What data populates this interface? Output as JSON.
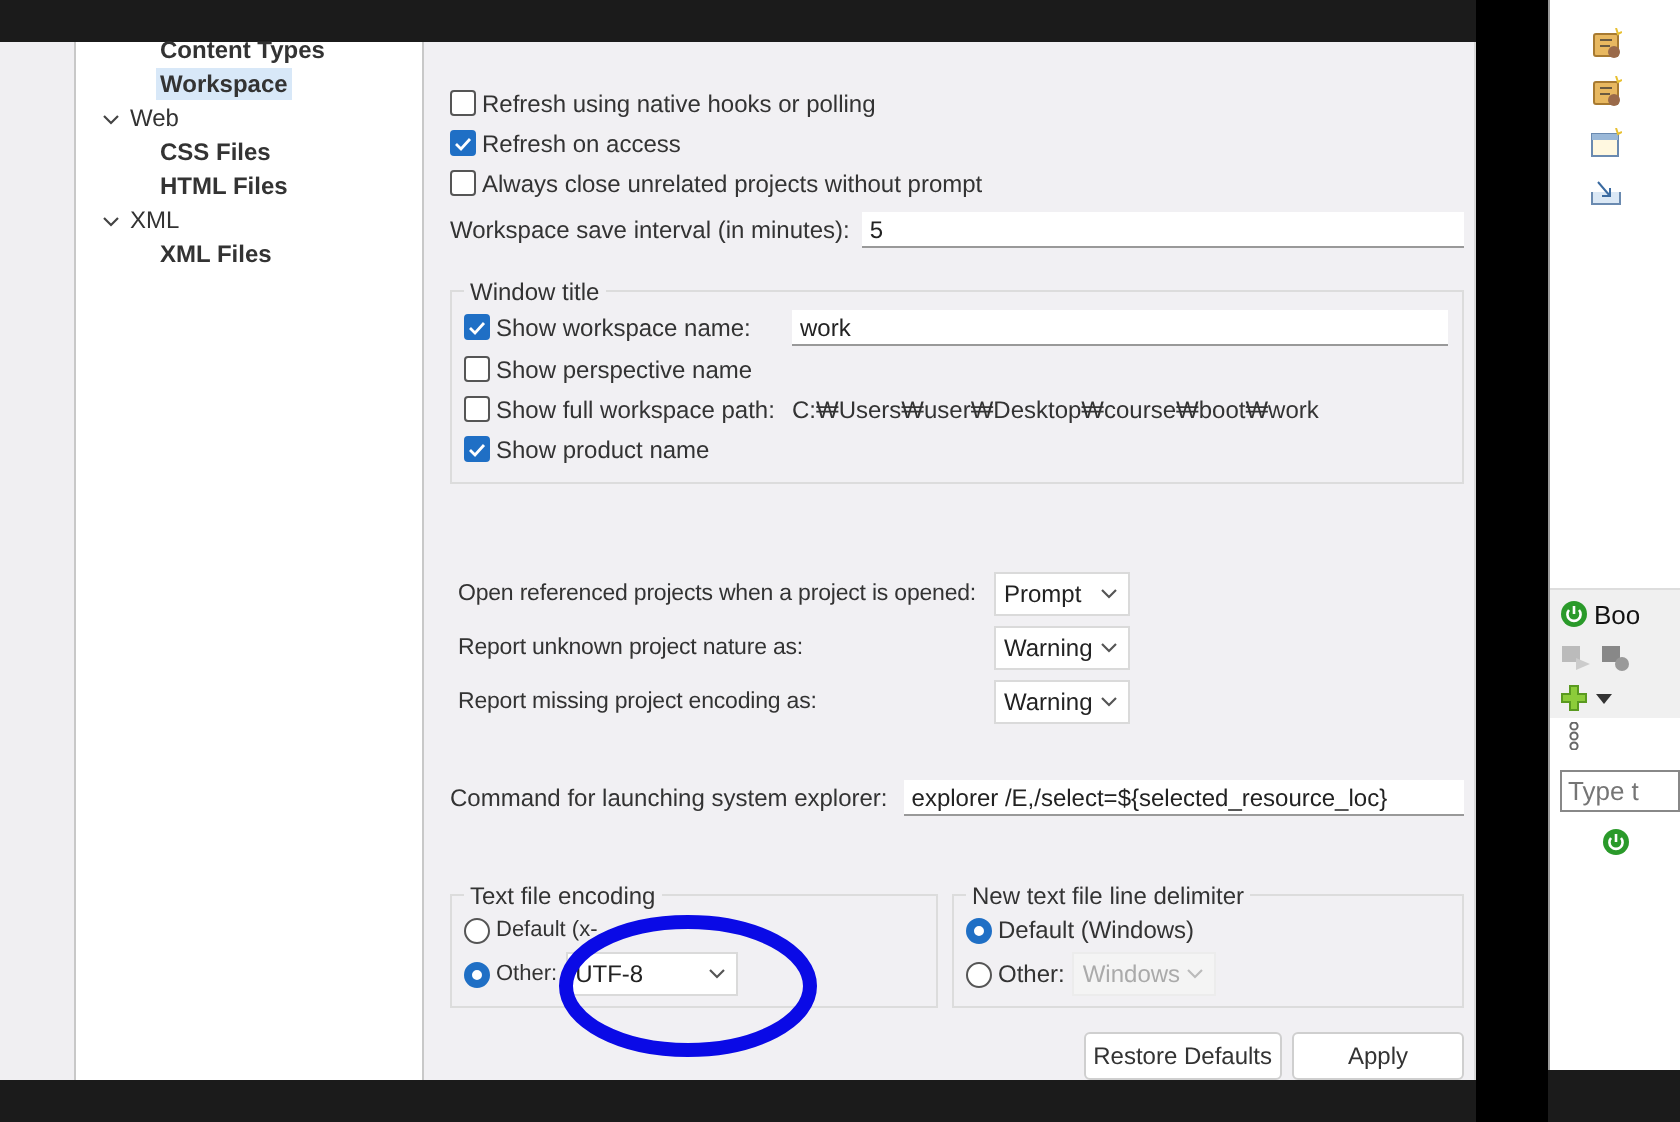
{
  "tree": [
    {
      "label": "Content Types",
      "selected": false
    },
    {
      "label": "Workspace",
      "selected": true
    },
    {
      "label": "Web",
      "expanded": true,
      "children": [
        {
          "label": "CSS Files",
          "selected": false
        },
        {
          "label": "HTML Files",
          "selected": false
        }
      ]
    },
    {
      "label": "XML",
      "expanded": true,
      "children": [
        {
          "label": "XML Files",
          "selected": false
        }
      ]
    }
  ],
  "options": [
    {
      "label": "Refresh using native hooks or polling",
      "checked": false
    },
    {
      "label": "Refresh on access",
      "checked": true
    },
    {
      "label": "Always close unrelated projects without prompt",
      "checked": false
    }
  ],
  "save_interval": {
    "label": "Workspace save interval (in minutes):",
    "value": "5"
  },
  "window_title": {
    "title": "Window title",
    "options": [
      {
        "kind": "field",
        "label": "Show workspace name:",
        "checked": true,
        "value": "work"
      },
      {
        "kind": "plain",
        "label": "Show perspective name",
        "checked": false
      },
      {
        "kind": "path",
        "label": "Show full workspace path:",
        "checked": false,
        "value": "C:₩Users₩user₩Desktop₩course₩boot₩work"
      },
      {
        "kind": "plain",
        "label": "Show product name",
        "checked": true
      }
    ]
  },
  "dropdowns": [
    {
      "label": "Open referenced projects when a project is opened:",
      "value": "Prompt"
    },
    {
      "label": "Report unknown project nature as:",
      "value": "Warning"
    },
    {
      "label": "Report missing project encoding as:",
      "value": "Warning"
    }
  ],
  "explorer_command": {
    "label": "Command for launching system explorer:",
    "value": "explorer /E,/select=${selected_resource_loc}"
  },
  "text_encoding": {
    "title": "Text file encoding",
    "options": [
      {
        "label": "Default (x-",
        "selected": false
      },
      {
        "label": "Other:",
        "selected": true,
        "value": "UTF-8",
        "disabled": false
      }
    ]
  },
  "line_delimiter": {
    "title": "New text file line delimiter",
    "options": [
      {
        "label": "Default (Windows)",
        "selected": true
      },
      {
        "label": "Other:",
        "selected": false,
        "value": "Windows",
        "disabled": true
      }
    ]
  },
  "buttons": [
    "Restore Defaults",
    "Apply"
  ],
  "side_panel": {
    "tab_title": "Boo",
    "filter_placeholder": "Type t"
  }
}
